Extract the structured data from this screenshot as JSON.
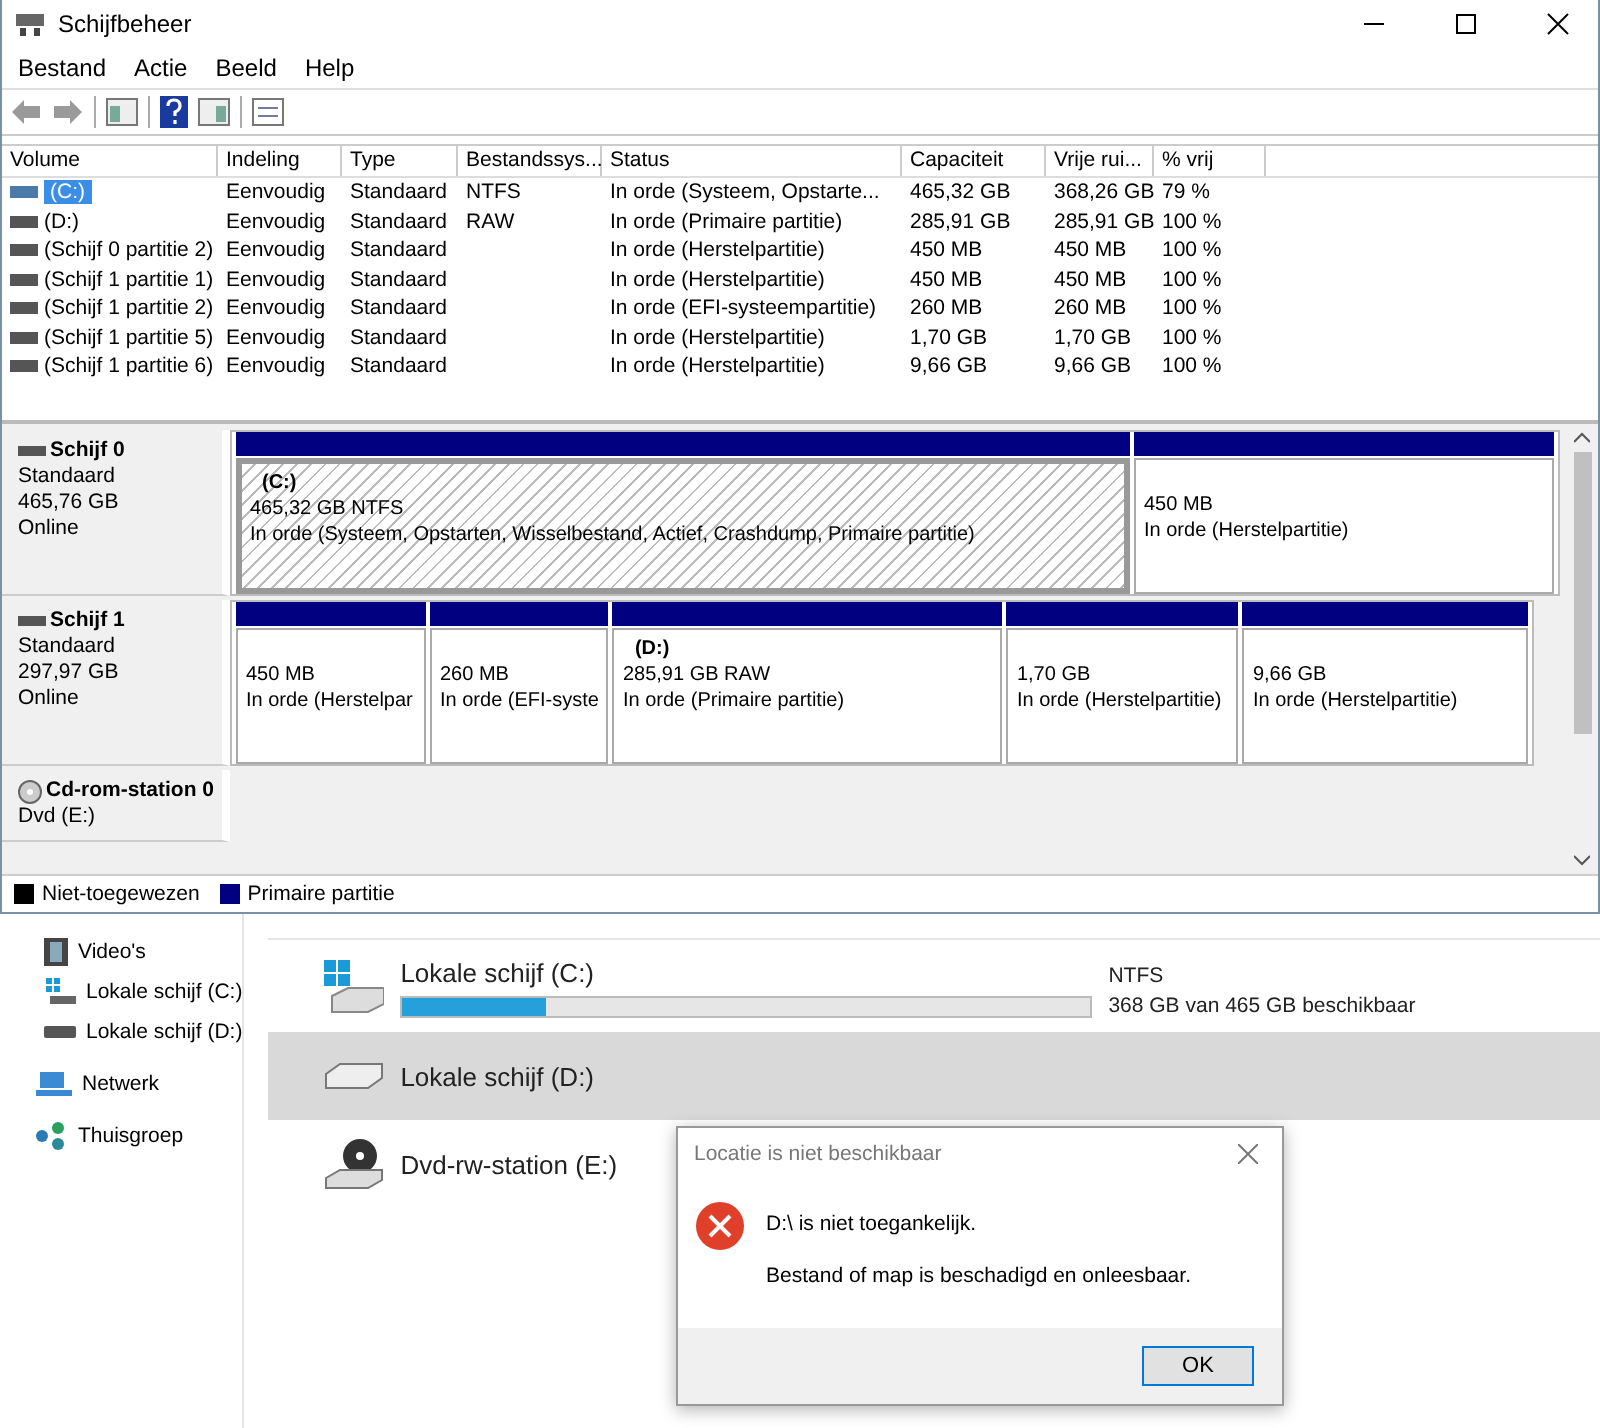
{
  "window": {
    "title": "Schijfbeheer"
  },
  "menu": [
    "Bestand",
    "Actie",
    "Beeld",
    "Help"
  ],
  "volume_table": {
    "columns": [
      "Volume",
      "Indeling",
      "Type",
      "Bestandssys...",
      "Status",
      "Capaciteit",
      "Vrije rui...",
      "% vrij"
    ],
    "rows": [
      {
        "selected": true,
        "cells": [
          "(C:)",
          "Eenvoudig",
          "Standaard",
          "NTFS",
          "In orde (Systeem, Opstarte...",
          "465,32 GB",
          "368,26 GB",
          "79 %"
        ]
      },
      {
        "selected": false,
        "cells": [
          "(D:)",
          "Eenvoudig",
          "Standaard",
          "RAW",
          "In orde (Primaire partitie)",
          "285,91 GB",
          "285,91 GB",
          "100 %"
        ]
      },
      {
        "selected": false,
        "cells": [
          "(Schijf 0 partitie 2)",
          "Eenvoudig",
          "Standaard",
          "",
          "In orde (Herstelpartitie)",
          "450 MB",
          "450 MB",
          "100 %"
        ]
      },
      {
        "selected": false,
        "cells": [
          "(Schijf 1 partitie 1)",
          "Eenvoudig",
          "Standaard",
          "",
          "In orde (Herstelpartitie)",
          "450 MB",
          "450 MB",
          "100 %"
        ]
      },
      {
        "selected": false,
        "cells": [
          "(Schijf 1 partitie 2)",
          "Eenvoudig",
          "Standaard",
          "",
          "In orde (EFI-systeempartitie)",
          "260 MB",
          "260 MB",
          "100 %"
        ]
      },
      {
        "selected": false,
        "cells": [
          "(Schijf 1 partitie 5)",
          "Eenvoudig",
          "Standaard",
          "",
          "In orde (Herstelpartitie)",
          "1,70 GB",
          "1,70 GB",
          "100 %"
        ]
      },
      {
        "selected": false,
        "cells": [
          "(Schijf 1 partitie 6)",
          "Eenvoudig",
          "Standaard",
          "",
          "In orde (Herstelpartitie)",
          "9,66 GB",
          "9,66 GB",
          "100 %"
        ]
      }
    ]
  },
  "disks": [
    {
      "kind": "disk",
      "name": "Schijf 0",
      "lines": [
        "Standaard",
        "465,76 GB",
        "Online"
      ],
      "partitions": [
        {
          "selected": true,
          "label": "(C:)",
          "size": "465,32 GB NTFS",
          "status": "In orde (Systeem, Opstarten, Wisselbestand, Actief, Crashdump, Primaire partitie)"
        },
        {
          "selected": false,
          "size": "450 MB",
          "status": "In orde (Herstelpartitie)"
        }
      ]
    },
    {
      "kind": "disk",
      "name": "Schijf 1",
      "lines": [
        "Standaard",
        "297,97 GB",
        "Online"
      ],
      "partitions": [
        {
          "selected": false,
          "size": "450 MB",
          "status": "In orde (Herstelpar"
        },
        {
          "selected": false,
          "size": "260 MB",
          "status": "In orde (EFI-syste"
        },
        {
          "selected": false,
          "label": "(D:)",
          "size": "285,91 GB RAW",
          "status": "In orde (Primaire partitie)"
        },
        {
          "selected": false,
          "size": "1,70 GB",
          "status": "In orde (Herstelpartitie)"
        },
        {
          "selected": false,
          "size": "9,66 GB",
          "status": "In orde (Herstelpartitie)"
        }
      ]
    },
    {
      "kind": "cdrom",
      "name": "Cd-rom-station 0",
      "lines": [
        "Dvd (E:)"
      ]
    }
  ],
  "legend": [
    {
      "label": "Niet-toegewezen",
      "color": "#000000"
    },
    {
      "label": "Primaire partitie",
      "color": "#000080"
    }
  ],
  "explorer": {
    "nav": [
      {
        "kind": "video",
        "label": "Video's"
      },
      {
        "kind": "windrive",
        "label": "Lokale schijf (C:)"
      },
      {
        "kind": "drive",
        "label": "Lokale schijf (D:)"
      },
      {
        "kind": "network",
        "label": "Netwerk"
      },
      {
        "kind": "homegroup",
        "label": "Thuisgroep"
      }
    ],
    "drives": [
      {
        "kind": "windrive",
        "name": "Lokale schijf (C:)",
        "selected": false,
        "level": 0.21,
        "filesystem": "NTFS",
        "free": "368 GB van 465 GB beschikbaar"
      },
      {
        "kind": "drive",
        "name": "Lokale schijf (D:)",
        "selected": true
      },
      {
        "kind": "dvd",
        "name": "Dvd-rw-station (E:)",
        "selected": false
      }
    ]
  },
  "dialog": {
    "title": "Locatie is niet beschikbaar",
    "message": "D:\\ is niet toegankelijk.",
    "detail": "Bestand of map is beschadigd en onleesbaar.",
    "button": "OK"
  }
}
